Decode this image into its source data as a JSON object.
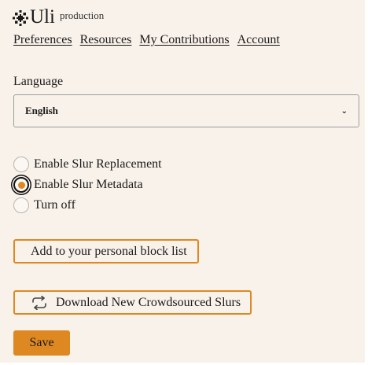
{
  "header": {
    "logo_text": "Uli",
    "environment": "production"
  },
  "nav": {
    "items": [
      {
        "label": "Preferences"
      },
      {
        "label": "Resources"
      },
      {
        "label": "My Contributions"
      },
      {
        "label": "Account"
      }
    ]
  },
  "language": {
    "label": "Language",
    "selected": "English"
  },
  "mode": {
    "options": [
      {
        "label": "Enable Slur Replacement",
        "checked": false
      },
      {
        "label": "Enable Slur Metadata",
        "checked": true
      },
      {
        "label": "Turn off",
        "checked": false
      }
    ]
  },
  "actions": {
    "block_list_label": "Add to your personal block list",
    "download_label": "Download New Crowdsourced Slurs",
    "download_icon": "refresh-icon",
    "save_label": "Save"
  },
  "colors": {
    "background": "#f9f2ea",
    "accent": "#de8821"
  }
}
